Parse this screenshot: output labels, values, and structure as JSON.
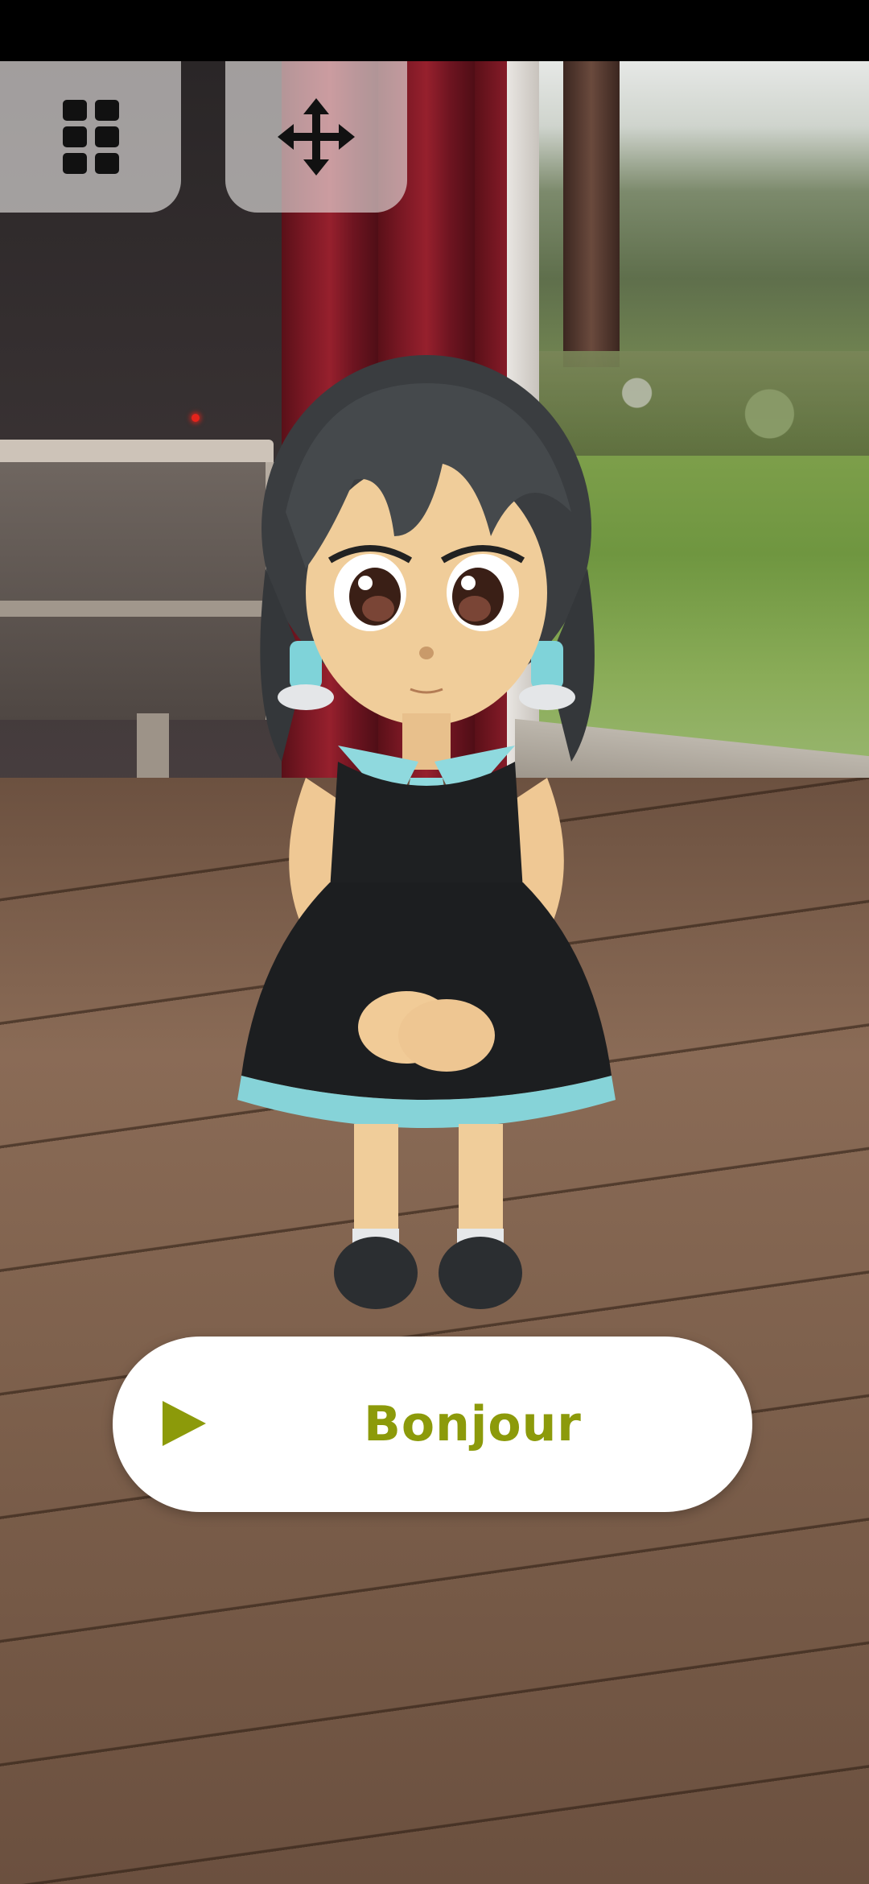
{
  "toolbar": {
    "menu_icon": "grid-icon",
    "move_icon": "move-arrows-icon"
  },
  "speech_button": {
    "icon": "play-icon",
    "label": "Bonjour"
  },
  "colors": {
    "accent": "#8c9a0a",
    "button_background": "#ffffff",
    "toolbar_button_background": "#ebe8e6"
  }
}
